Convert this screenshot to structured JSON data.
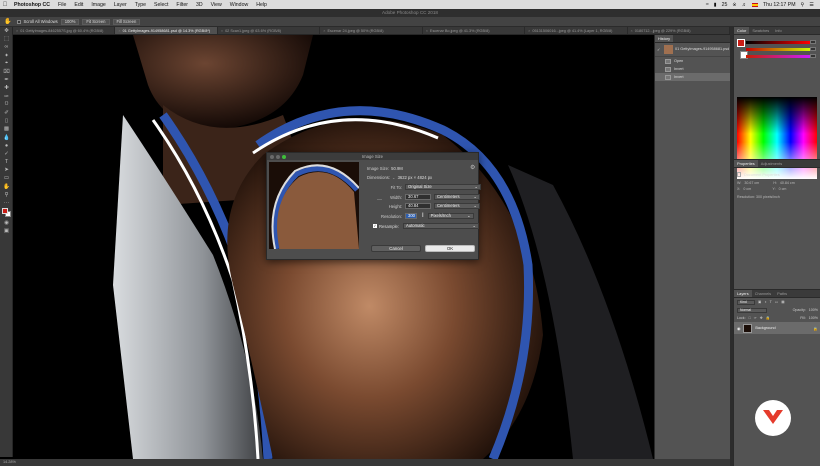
{
  "menubar": {
    "items": [
      "Photoshop CC",
      "File",
      "Edit",
      "Image",
      "Layer",
      "Type",
      "Select",
      "Filter",
      "3D",
      "View",
      "Window",
      "Help"
    ],
    "clock": "Thu 12:17 PM",
    "battery": "25"
  },
  "window": {
    "title": "Adobe Photoshop CC 2018"
  },
  "options": {
    "scroll_all": "Scroll All Windows",
    "zoom": "100%",
    "fit_screen": "Fit Screen",
    "fill_screen": "Fill Screen"
  },
  "tabs": [
    "01 GettyImages-8462557S.jpg @ 60.4% (RGB/8)",
    "01 GettyImages-914958681.psd @ 14.3% (RGB/8*)",
    "02 Scan1.jpeg @ 63.6% (RGB/8)",
    "Escenar 24.jpeg @ 50% (RGB/8)",
    "Escenar Bo.jpeg @ 41.3% (RGB/8)",
    "05131506016...jpeg @ 41.4% (Layer 1, RGB/8)",
    "0180712...jpeg @ 229% (RGB/8)"
  ],
  "active_tab": 1,
  "status": "14.28%",
  "dialog": {
    "title": "Image Size",
    "image_size_label": "Image Size:",
    "image_size_value": "50.9M",
    "dimensions_label": "Dimensions:",
    "dimensions_value": "3622 px  ×  4824 px",
    "fit_to_label": "Fit To:",
    "fit_to_value": "Original Size",
    "width_label": "Width:",
    "width_value": "30.67",
    "width_unit": "Centimeters",
    "height_label": "Height:",
    "height_value": "40.84",
    "height_unit": "Centimeters",
    "resolution_label": "Resolution:",
    "resolution_value": "300",
    "resolution_unit": "Pixels/Inch",
    "resample_label": "Resample:",
    "resample_value": "Automatic",
    "cancel": "Cancel",
    "ok": "OK"
  },
  "history": {
    "tab": "History",
    "snapshot": "01 GettyImages-914958681.psd",
    "items": [
      "Open",
      "Invert",
      "Invert"
    ],
    "selected": 2
  },
  "color_panel": {
    "tabs": [
      "Color",
      "Swatches",
      "Info"
    ],
    "active": 0,
    "foreground": "#c91d16",
    "background": "#ffffff"
  },
  "properties": {
    "tabs": [
      "Properties",
      "Adjustments"
    ],
    "active": 0,
    "heading": "Document Properties",
    "w_label": "W:",
    "w_value": "30.67 cm",
    "h_label": "H:",
    "h_value": "40.84 cm",
    "x_label": "X:",
    "x_value": "0 cm",
    "y_label": "Y:",
    "y_value": "0 cm",
    "resolution": "Resolution: 300 pixels/inch"
  },
  "layers": {
    "tabs": [
      "Layers",
      "Channels",
      "Paths"
    ],
    "active": 0,
    "kind": "Kind",
    "mode": "Normal",
    "opacity_label": "Opacity:",
    "opacity_value": "100%",
    "lock_label": "Lock:",
    "fill_label": "Fill:",
    "fill_value": "100%",
    "layer_name": "Background"
  }
}
